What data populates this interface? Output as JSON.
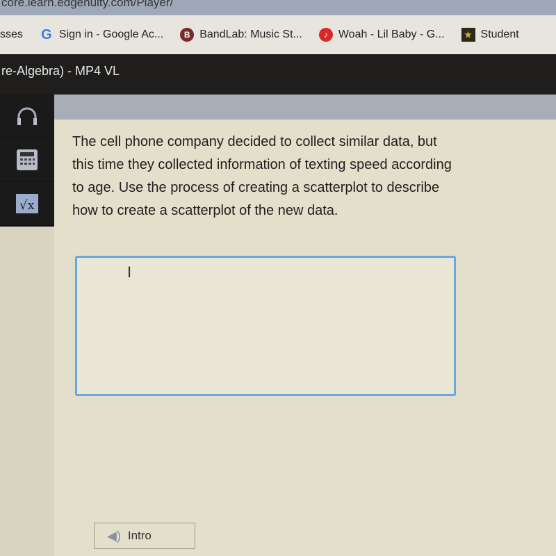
{
  "browser": {
    "url": "core.learn.edgenuity.com/Player/",
    "bookmarks": [
      {
        "label": "sses",
        "icon": "none"
      },
      {
        "label": "Sign in - Google Ac...",
        "icon": "google-icon"
      },
      {
        "label": "BandLab: Music St...",
        "icon": "bandlab-icon"
      },
      {
        "label": "Woah - Lil Baby - G...",
        "icon": "music-icon"
      },
      {
        "label": "Student",
        "icon": "star-icon"
      }
    ]
  },
  "title": "re-Algebra) - MP4  VL",
  "sidebar": {
    "items": [
      {
        "icon": "headphones-icon"
      },
      {
        "icon": "calculator-icon"
      },
      {
        "icon": "formula-icon"
      }
    ]
  },
  "question": "The cell phone company decided to collect similar data, but this time they collected information of texting speed according to age. Use the process of creating a scatterplot to describe how to create a scatterplot of the new data.",
  "answer": {
    "value": ""
  },
  "intro_button": "Intro",
  "colors": {
    "accent": "#6aa8dc",
    "content_bg": "#e4dfca",
    "sidebar_bg": "#1a1a1a"
  }
}
